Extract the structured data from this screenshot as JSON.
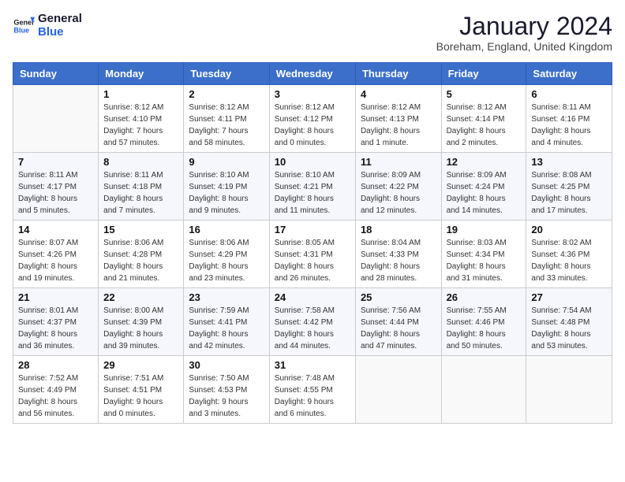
{
  "header": {
    "logo_line1": "General",
    "logo_line2": "Blue",
    "month_year": "January 2024",
    "location": "Boreham, England, United Kingdom"
  },
  "days_of_week": [
    "Sunday",
    "Monday",
    "Tuesday",
    "Wednesday",
    "Thursday",
    "Friday",
    "Saturday"
  ],
  "weeks": [
    [
      {
        "day": "",
        "info": ""
      },
      {
        "day": "1",
        "info": "Sunrise: 8:12 AM\nSunset: 4:10 PM\nDaylight: 7 hours\nand 57 minutes."
      },
      {
        "day": "2",
        "info": "Sunrise: 8:12 AM\nSunset: 4:11 PM\nDaylight: 7 hours\nand 58 minutes."
      },
      {
        "day": "3",
        "info": "Sunrise: 8:12 AM\nSunset: 4:12 PM\nDaylight: 8 hours\nand 0 minutes."
      },
      {
        "day": "4",
        "info": "Sunrise: 8:12 AM\nSunset: 4:13 PM\nDaylight: 8 hours\nand 1 minute."
      },
      {
        "day": "5",
        "info": "Sunrise: 8:12 AM\nSunset: 4:14 PM\nDaylight: 8 hours\nand 2 minutes."
      },
      {
        "day": "6",
        "info": "Sunrise: 8:11 AM\nSunset: 4:16 PM\nDaylight: 8 hours\nand 4 minutes."
      }
    ],
    [
      {
        "day": "7",
        "info": "Sunrise: 8:11 AM\nSunset: 4:17 PM\nDaylight: 8 hours\nand 5 minutes."
      },
      {
        "day": "8",
        "info": "Sunrise: 8:11 AM\nSunset: 4:18 PM\nDaylight: 8 hours\nand 7 minutes."
      },
      {
        "day": "9",
        "info": "Sunrise: 8:10 AM\nSunset: 4:19 PM\nDaylight: 8 hours\nand 9 minutes."
      },
      {
        "day": "10",
        "info": "Sunrise: 8:10 AM\nSunset: 4:21 PM\nDaylight: 8 hours\nand 11 minutes."
      },
      {
        "day": "11",
        "info": "Sunrise: 8:09 AM\nSunset: 4:22 PM\nDaylight: 8 hours\nand 12 minutes."
      },
      {
        "day": "12",
        "info": "Sunrise: 8:09 AM\nSunset: 4:24 PM\nDaylight: 8 hours\nand 14 minutes."
      },
      {
        "day": "13",
        "info": "Sunrise: 8:08 AM\nSunset: 4:25 PM\nDaylight: 8 hours\nand 17 minutes."
      }
    ],
    [
      {
        "day": "14",
        "info": "Sunrise: 8:07 AM\nSunset: 4:26 PM\nDaylight: 8 hours\nand 19 minutes."
      },
      {
        "day": "15",
        "info": "Sunrise: 8:06 AM\nSunset: 4:28 PM\nDaylight: 8 hours\nand 21 minutes."
      },
      {
        "day": "16",
        "info": "Sunrise: 8:06 AM\nSunset: 4:29 PM\nDaylight: 8 hours\nand 23 minutes."
      },
      {
        "day": "17",
        "info": "Sunrise: 8:05 AM\nSunset: 4:31 PM\nDaylight: 8 hours\nand 26 minutes."
      },
      {
        "day": "18",
        "info": "Sunrise: 8:04 AM\nSunset: 4:33 PM\nDaylight: 8 hours\nand 28 minutes."
      },
      {
        "day": "19",
        "info": "Sunrise: 8:03 AM\nSunset: 4:34 PM\nDaylight: 8 hours\nand 31 minutes."
      },
      {
        "day": "20",
        "info": "Sunrise: 8:02 AM\nSunset: 4:36 PM\nDaylight: 8 hours\nand 33 minutes."
      }
    ],
    [
      {
        "day": "21",
        "info": "Sunrise: 8:01 AM\nSunset: 4:37 PM\nDaylight: 8 hours\nand 36 minutes."
      },
      {
        "day": "22",
        "info": "Sunrise: 8:00 AM\nSunset: 4:39 PM\nDaylight: 8 hours\nand 39 minutes."
      },
      {
        "day": "23",
        "info": "Sunrise: 7:59 AM\nSunset: 4:41 PM\nDaylight: 8 hours\nand 42 minutes."
      },
      {
        "day": "24",
        "info": "Sunrise: 7:58 AM\nSunset: 4:42 PM\nDaylight: 8 hours\nand 44 minutes."
      },
      {
        "day": "25",
        "info": "Sunrise: 7:56 AM\nSunset: 4:44 PM\nDaylight: 8 hours\nand 47 minutes."
      },
      {
        "day": "26",
        "info": "Sunrise: 7:55 AM\nSunset: 4:46 PM\nDaylight: 8 hours\nand 50 minutes."
      },
      {
        "day": "27",
        "info": "Sunrise: 7:54 AM\nSunset: 4:48 PM\nDaylight: 8 hours\nand 53 minutes."
      }
    ],
    [
      {
        "day": "28",
        "info": "Sunrise: 7:52 AM\nSunset: 4:49 PM\nDaylight: 8 hours\nand 56 minutes."
      },
      {
        "day": "29",
        "info": "Sunrise: 7:51 AM\nSunset: 4:51 PM\nDaylight: 9 hours\nand 0 minutes."
      },
      {
        "day": "30",
        "info": "Sunrise: 7:50 AM\nSunset: 4:53 PM\nDaylight: 9 hours\nand 3 minutes."
      },
      {
        "day": "31",
        "info": "Sunrise: 7:48 AM\nSunset: 4:55 PM\nDaylight: 9 hours\nand 6 minutes."
      },
      {
        "day": "",
        "info": ""
      },
      {
        "day": "",
        "info": ""
      },
      {
        "day": "",
        "info": ""
      }
    ]
  ]
}
